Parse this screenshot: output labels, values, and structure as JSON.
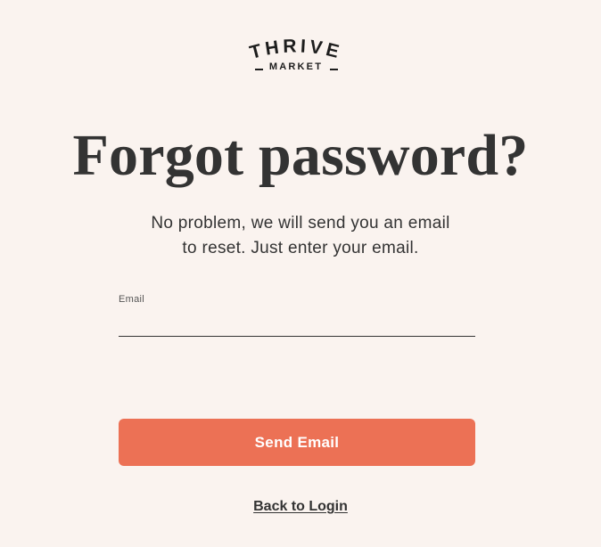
{
  "brand": {
    "logo_top": "THRIVE",
    "logo_bottom": "MARKET"
  },
  "page": {
    "title": "Forgot password?",
    "subtitle_line1": "No problem, we will send you an email",
    "subtitle_line2": "to reset. Just enter your email."
  },
  "form": {
    "email_label": "Email",
    "email_value": "",
    "email_placeholder": ""
  },
  "actions": {
    "send_label": "Send Email",
    "back_label": "Back to Login"
  },
  "colors": {
    "background": "#faf3ef",
    "accent": "#ec7155",
    "text": "#333333"
  }
}
